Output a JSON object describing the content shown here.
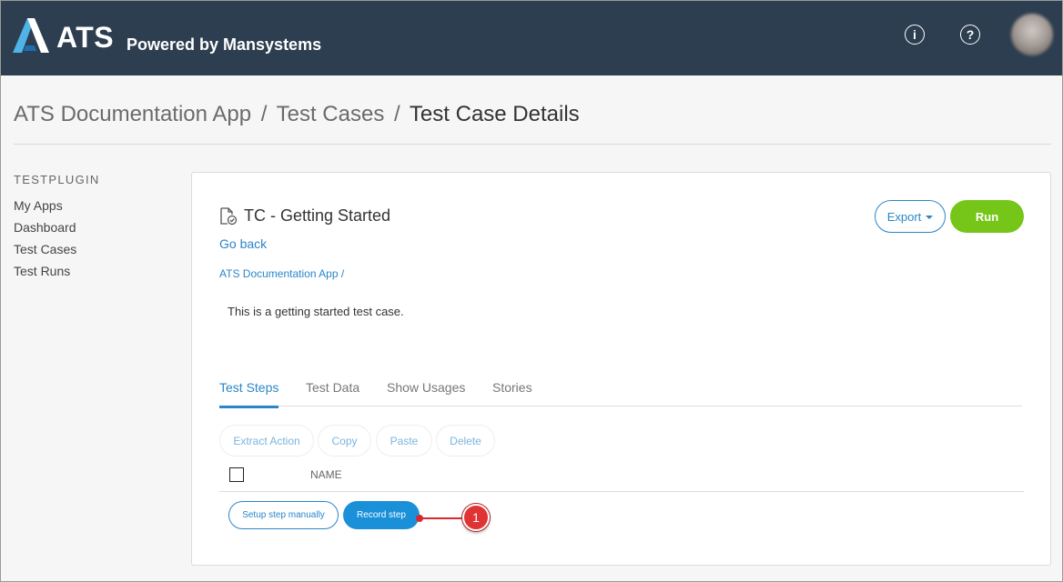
{
  "header": {
    "brand": "ATS",
    "tagline": "Powered by Mansystems",
    "info_icon_glyph": "i",
    "help_icon_glyph": "?",
    "colors": {
      "background": "#2d3e50",
      "logo_light": "#4fb3e8",
      "logo_dark": "#1b6fb0"
    }
  },
  "breadcrumb": {
    "items": [
      "ATS Documentation App",
      "Test Cases",
      "Test Case Details"
    ],
    "separator": "/"
  },
  "sidebar": {
    "title": "TESTPLUGIN",
    "items": [
      {
        "label": "My Apps"
      },
      {
        "label": "Dashboard"
      },
      {
        "label": "Test Cases"
      },
      {
        "label": "Test Runs"
      }
    ]
  },
  "test_case": {
    "title": "TC - Getting Started",
    "go_back": "Go back",
    "app_link": "ATS Documentation App /",
    "description": "This is a getting started test case.",
    "export_label": "Export",
    "run_label": "Run"
  },
  "tabs": [
    {
      "label": "Test Steps",
      "active": true
    },
    {
      "label": "Test Data",
      "active": false
    },
    {
      "label": "Show Usages",
      "active": false
    },
    {
      "label": "Stories",
      "active": false
    }
  ],
  "actions": {
    "extract": "Extract Action",
    "copy": "Copy",
    "paste": "Paste",
    "delete": "Delete"
  },
  "steps_table": {
    "column_name": "NAME",
    "setup_label": "Setup step manually",
    "record_label": "Record step"
  },
  "annotation": {
    "number": "1",
    "color": "#e03333"
  }
}
